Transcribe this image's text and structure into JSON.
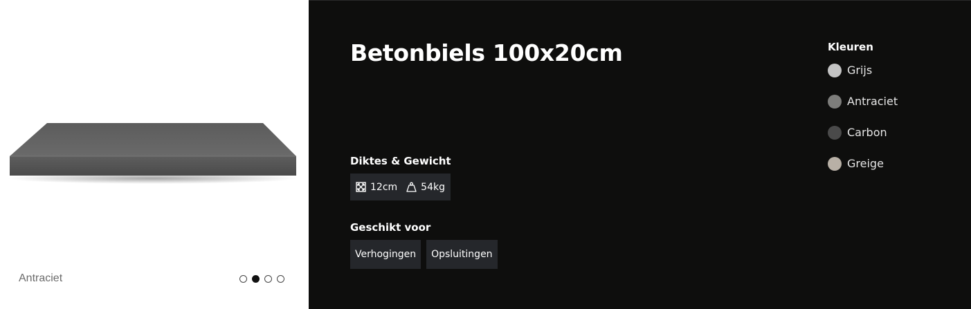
{
  "product": {
    "title": "Betonbiels 100x20cm",
    "image_caption": "Antraciet",
    "carousel": {
      "total": 4,
      "active_index": 1
    }
  },
  "specs": {
    "heading": "Diktes & Gewicht",
    "thickness": "12cm",
    "thickness_icon": "dimension-icon",
    "weight": "54kg",
    "weight_icon": "weight-icon"
  },
  "usage": {
    "heading": "Geschikt voor",
    "tags": [
      "Verhogingen",
      "Opsluitingen"
    ]
  },
  "colors": {
    "heading": "Kleuren",
    "items": [
      {
        "label": "Grijs",
        "swatch": "#c4c4c4"
      },
      {
        "label": "Antraciet",
        "swatch": "#7d7d7b"
      },
      {
        "label": "Carbon",
        "swatch": "#4a4a4a"
      },
      {
        "label": "Greige",
        "swatch": "#b8b0a6"
      }
    ]
  },
  "theme": {
    "panel_bg": "#0e0e0d",
    "chip_bg": "#25272b"
  }
}
